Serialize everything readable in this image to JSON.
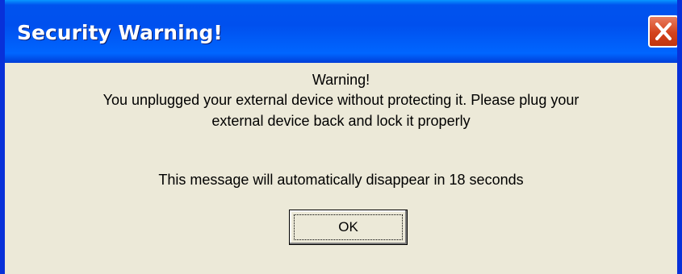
{
  "window": {
    "title": "Security Warning!",
    "close_icon": "close-icon"
  },
  "message": {
    "heading": "Warning!",
    "line1": "You unplugged your external device without protecting it. Please plug your",
    "line2": "external device back and lock it properly",
    "countdown": "This message will automatically disappear in 18 seconds"
  },
  "buttons": {
    "ok_label": "OK"
  },
  "colors": {
    "titlebar": "#0054e3",
    "window_border": "#0831d9",
    "dialog_bg": "#ece9d8",
    "close_button": "#d4431c"
  }
}
